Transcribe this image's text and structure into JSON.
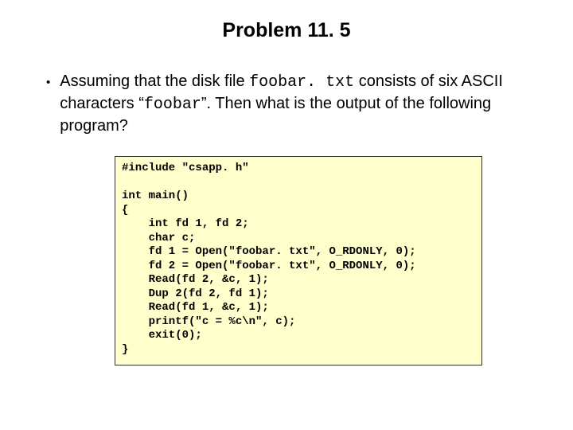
{
  "title": "Problem 11. 5",
  "bullet": {
    "pre": "Assuming that the disk file ",
    "file": "foobar. txt",
    "mid1": " consists of six ASCII characters “",
    "ascii": "foobar",
    "mid2": "”.  Then what is the output of the following program?"
  },
  "code": "#include \"csapp. h\"\n\nint main()\n{\n    int fd 1, fd 2;\n    char c;\n    fd 1 = Open(\"foobar. txt\", O_RDONLY, 0);\n    fd 2 = Open(\"foobar. txt\", O_RDONLY, 0);\n    Read(fd 2, &c, 1);\n    Dup 2(fd 2, fd 1);\n    Read(fd 1, &c, 1);\n    printf(\"c = %c\\n\", c);\n    exit(0);\n}"
}
